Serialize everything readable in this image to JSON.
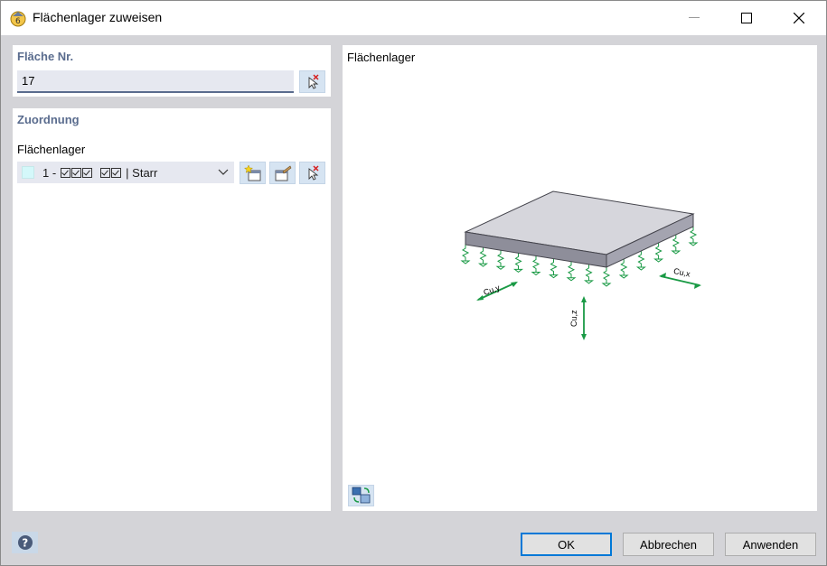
{
  "window": {
    "title": "Flächenlager zuweisen"
  },
  "face": {
    "section_title": "Fläche Nr.",
    "value": "17"
  },
  "assignment": {
    "section_title": "Zuordnung",
    "support_label": "Flächenlager",
    "support_select": {
      "prefix": "1 -",
      "suffix": "| Starr",
      "swatch_color": "#d4f8fa"
    }
  },
  "preview": {
    "title": "Flächenlager",
    "labels": {
      "cuy": "Cu,y",
      "cux": "Cu,x",
      "cuz": "Cu,z"
    },
    "colors": {
      "spring": "#1a9a45",
      "plate_top": "#d6d6dc",
      "plate_side": "#8e8e9a"
    }
  },
  "buttons": {
    "ok": "OK",
    "cancel": "Abbrechen",
    "apply": "Anwenden"
  },
  "icons": {
    "app": "support-assign-icon",
    "pick": "pick-cursor-icon",
    "new": "new-item-icon",
    "edit": "edit-item-icon",
    "view": "view-change-icon",
    "help": "help-icon"
  }
}
